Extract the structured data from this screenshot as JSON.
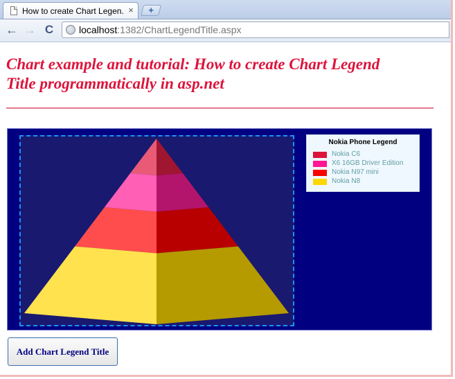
{
  "browser": {
    "tab_title": "How to create Chart Legen...",
    "close_glyph": "×",
    "newtab_glyph": "+",
    "back_glyph": "←",
    "forward_glyph": "→",
    "reload_glyph": "C",
    "url_host": "localhost",
    "url_rest": ":1382/ChartLegendTitle.aspx"
  },
  "page": {
    "title_line1": "Chart example and tutorial: How to create Chart Legend",
    "title_line2": "Title programmatically in asp.net",
    "button_label": "Add Chart Legend Title"
  },
  "colors": {
    "title": "#dc143c",
    "chart_back": "#000080",
    "plot_back": "#191970",
    "legend_back": "#f0f8ff"
  },
  "chart_data": {
    "type": "pyramid",
    "legend_title": "Nokia Phone Legend",
    "series": [
      {
        "name": "Nokia C6",
        "color": "#dc143c",
        "light": "#e85a76",
        "dark": "#a01530"
      },
      {
        "name": "X6 16GB Driver Edition",
        "color": "#ff1493",
        "light": "#ff5fb4",
        "dark": "#b3156c"
      },
      {
        "name": "Nokia N97 mini",
        "color": "#ff0000",
        "light": "#ff4d4d",
        "dark": "#b80000"
      },
      {
        "name": "Nokia N8",
        "color": "#ffd700",
        "light": "#ffe24d",
        "dark": "#b59a00"
      }
    ],
    "segment_heights": [
      55,
      54,
      62,
      106
    ]
  }
}
